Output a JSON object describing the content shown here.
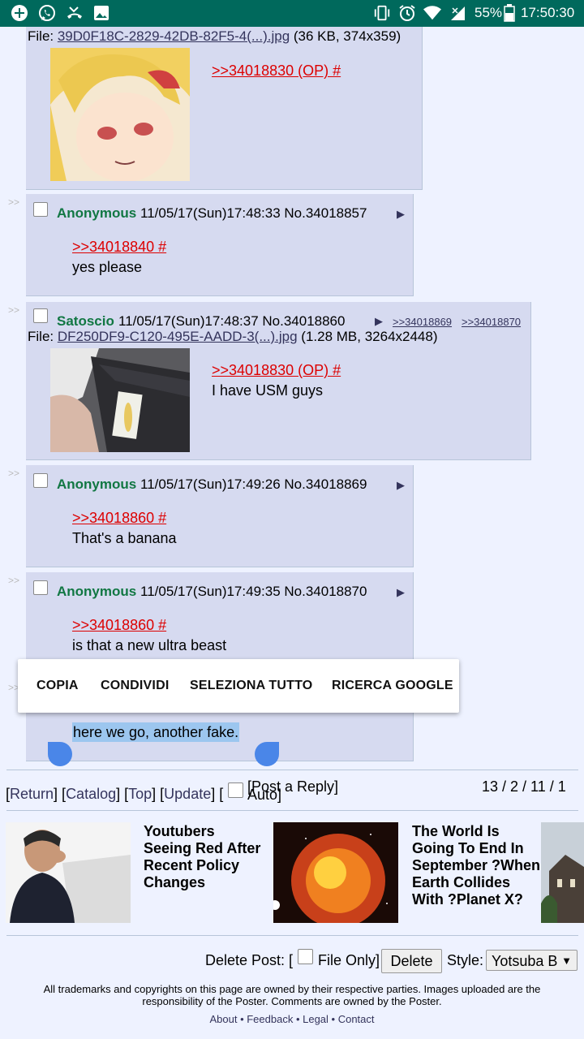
{
  "status_bar": {
    "battery": "55%",
    "time": "17:50:30",
    "left_icons": [
      "plus-circle-icon",
      "whatsapp-icon",
      "missed-call-icon",
      "image-icon"
    ],
    "right_icons": [
      "vibrate-icon",
      "alarm-icon",
      "wifi-icon",
      "signal-icon",
      "battery-icon"
    ]
  },
  "posts": [
    {
      "file_label": "File: ",
      "file_link": "39D0F18C-2829-42DB-82F5-4(...).jpg",
      "file_meta": " (36 KB, 374x359)",
      "quote": ">>34018830 (OP) #"
    },
    {
      "arrows": ">>",
      "name": "Anonymous",
      "datetime": "11/05/17(Sun)17:48:33 No.34018857",
      "menu": "▶",
      "quote": ">>34018840 #",
      "message": "yes please"
    },
    {
      "arrows": ">>",
      "name": "Satoscio",
      "datetime": "11/05/17(Sun)17:48:37 No.34018860",
      "menu": "▶",
      "backlinks": [
        ">>34018869",
        ">>34018870"
      ],
      "file_label": "File: ",
      "file_link": "DF250DF9-C120-495E-AADD-3(...).jpg",
      "file_meta": " (1.28 MB, 3264x2448)",
      "quote": ">>34018830 (OP) #",
      "message": "I have USM guys"
    },
    {
      "arrows": ">>",
      "name": "Anonymous",
      "datetime": "11/05/17(Sun)17:49:26 No.34018869",
      "menu": "▶",
      "quote": ">>34018860 #",
      "message": "That's a banana"
    },
    {
      "arrows": ">>",
      "name": "Anonymous",
      "datetime": "11/05/17(Sun)17:49:35 No.34018870",
      "menu": "▶",
      "quote": ">>34018860 #",
      "message": "is that a new ultra beast"
    },
    {
      "arrows": ">>",
      "selected_message": "here we go, another fake."
    }
  ],
  "context_menu": {
    "copy": "COPIA",
    "share": "CONDIVIDI",
    "select_all": "SELEZIONA TUTTO",
    "google_search": "RICERCA GOOGLE"
  },
  "thread_nav": {
    "open1": "[",
    "return": "Return",
    "close1": "] [",
    "catalog": "Catalog",
    "close2": "] [",
    "top": "Top",
    "close3": "] [",
    "update": "Update",
    "close4": "] [",
    "auto": "Auto]",
    "post_reply": "[Post a Reply]",
    "stats": "13 / 2 / 11 / 1"
  },
  "ads": [
    {
      "title": "Youtubers Seeing Red After Recent Policy Changes"
    },
    {
      "title": "The World Is Going To End In September ?When Earth Collides With ?Planet X?"
    }
  ],
  "delete_form": {
    "label": "Delete Post: [",
    "file_only": "File Only]",
    "delete_button": "Delete",
    "style_label": "Style:",
    "style_value": "Yotsuba B"
  },
  "footer": {
    "disclaimer": "All trademarks and copyrights on this page are owned by their respective parties. Images uploaded are the responsibility of the Poster. Comments are owned by the Poster.",
    "about": "About",
    "feedback": "Feedback",
    "legal": "Legal",
    "contact": "Contact",
    "sep": " • "
  }
}
